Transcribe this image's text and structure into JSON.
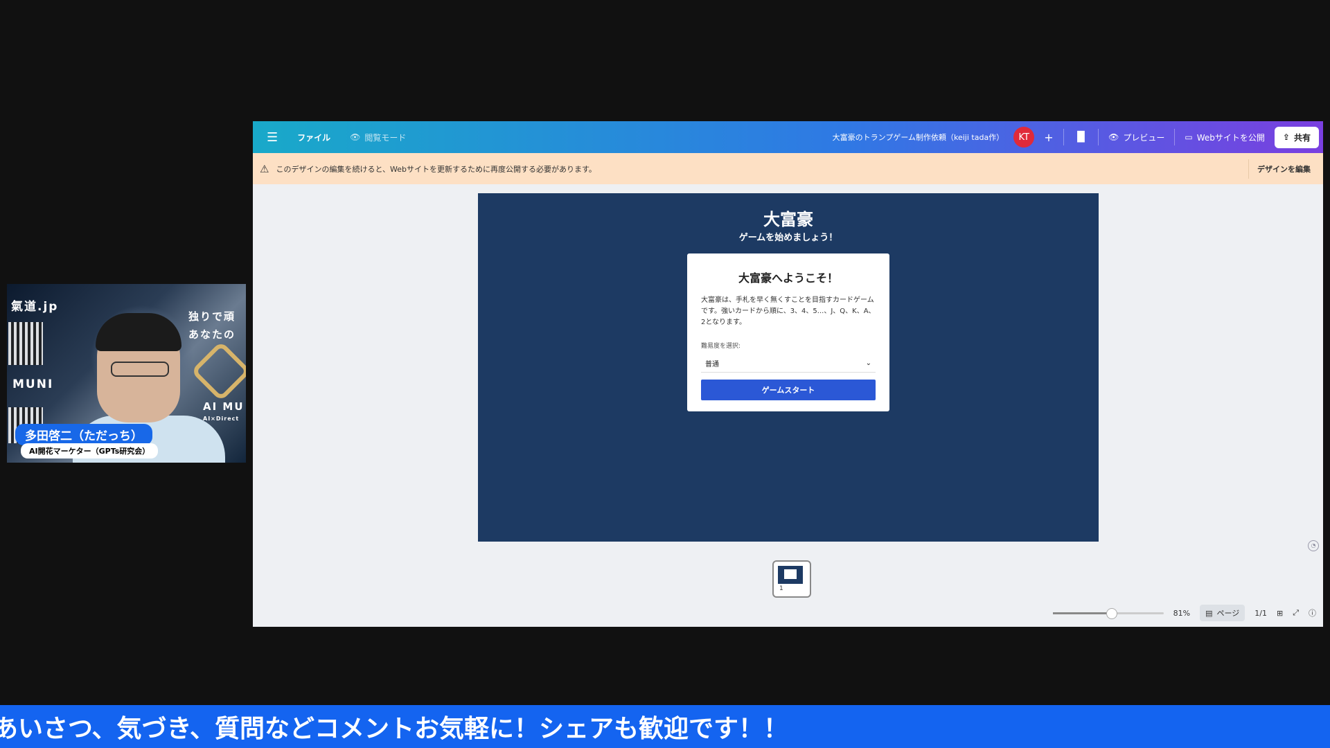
{
  "webcam": {
    "overlay_site": "氣道.jp",
    "overlay_phrase_1": "独りで頑",
    "overlay_phrase_2": "あなたの",
    "overlay_muni": "MUNI",
    "overlay_aimu": "AI MU",
    "overlay_small": "AI×Direct",
    "name": "多田啓二（ただっち）",
    "title": "AI開花マーケター（GPTs研究会）"
  },
  "topbar": {
    "menu_icon": "hamburger-icon",
    "file_label": "ファイル",
    "view_mode_label": "閲覧モード",
    "doc_title": "大富豪のトランプゲーム制作依頼（keiji tada作）",
    "avatar_initials": "KT",
    "plus_label": "+",
    "preview_label": "プレビュー",
    "publish_label": "Webサイトを公開",
    "share_label": "共有"
  },
  "notice": {
    "message": "このデザインの編集を続けると、Webサイトを更新するために再度公開する必要があります。",
    "edit_label": "デザインを編集"
  },
  "game": {
    "title": "大富豪",
    "subtitle": "ゲームを始めましょう！",
    "card_title": "大富豪へようこそ！",
    "card_desc": "大富豪は、手札を早く無くすことを目指すカードゲームです。強いカードから順に、3、4、5...、J、Q、K、A、2となります。",
    "difficulty_label": "難易度を選択:",
    "difficulty_value": "普通",
    "start_label": "ゲームスタート"
  },
  "footer": {
    "zoom": "81%",
    "zoom_fraction": 0.53,
    "page_label": "ページ",
    "page_count": "1/1",
    "thumb_number": "1"
  },
  "banner": {
    "text": "あいさつ、気づき、質問などコメントお気軽に！シェアも歓迎です！！"
  },
  "colors": {
    "canvas_bg": "#1d3a63",
    "start_btn": "#2b58d6",
    "banner_bg": "#1464f0",
    "notice_bg": "#fde0c4",
    "avatar_bg": "#e02a3a"
  }
}
